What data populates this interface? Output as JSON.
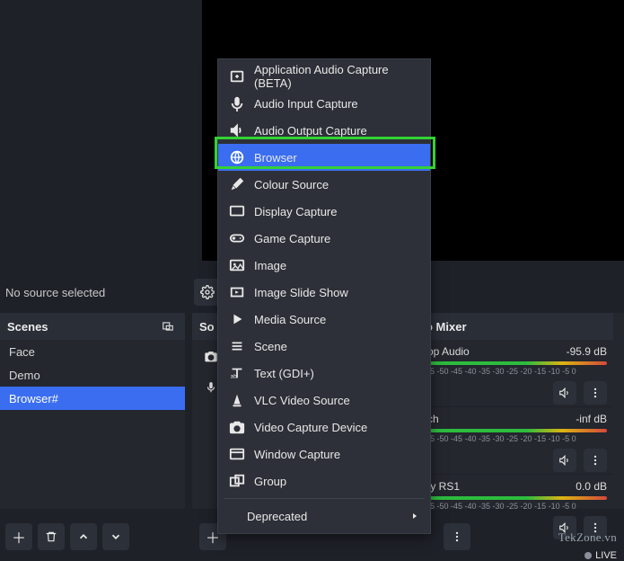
{
  "status": {
    "no_source": "No source selected"
  },
  "scenes": {
    "title": "Scenes",
    "items": [
      "Face",
      "Demo",
      "Browser#"
    ],
    "selected_index": 2
  },
  "sources": {
    "title": "So"
  },
  "mixer": {
    "title": "o Mixer",
    "ticks": "-5  -50  -45  -40  -35  -30  -25  -20  -15  -10  -5   0",
    "rows": [
      {
        "label": "op Audio",
        "db": "-95.9 dB"
      },
      {
        "label": "ch",
        "db": "-inf dB"
      },
      {
        "label": "ty RS1",
        "db": "0.0 dB"
      }
    ]
  },
  "context_menu": {
    "items": [
      {
        "icon": "app-audio-icon",
        "label": "Application Audio Capture (BETA)"
      },
      {
        "icon": "mic-icon",
        "label": "Audio Input Capture"
      },
      {
        "icon": "speaker-out-icon",
        "label": "Audio Output Capture"
      },
      {
        "icon": "globe-icon",
        "label": "Browser",
        "selected": true
      },
      {
        "icon": "brush-icon",
        "label": "Colour Source"
      },
      {
        "icon": "screen-icon",
        "label": "Display Capture"
      },
      {
        "icon": "gamepad-icon",
        "label": "Game Capture"
      },
      {
        "icon": "image-icon",
        "label": "Image"
      },
      {
        "icon": "slideshow-icon",
        "label": "Image Slide Show"
      },
      {
        "icon": "play-icon",
        "label": "Media Source"
      },
      {
        "icon": "list-icon",
        "label": "Scene"
      },
      {
        "icon": "text-icon",
        "label": "Text (GDI+)"
      },
      {
        "icon": "cone-icon",
        "label": "VLC Video Source"
      },
      {
        "icon": "camera-icon",
        "label": "Video Capture Device"
      },
      {
        "icon": "window-icon",
        "label": "Window Capture"
      },
      {
        "icon": "group-icon",
        "label": "Group"
      }
    ],
    "deprecated_label": "Deprecated"
  },
  "watermark": "TekZone.vn",
  "live": "LIVE"
}
